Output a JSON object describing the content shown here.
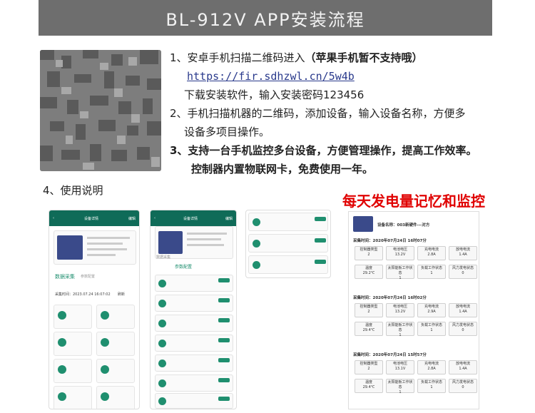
{
  "banner": {
    "title": "BL-912V APP安装流程"
  },
  "steps": {
    "s1": "1、安卓手机扫描二维码进入",
    "s1_bold": "（苹果手机暂不支持哦）",
    "link": "https://fir.sdhzwl.cn/5w4b",
    "s1b": "下载安装软件，输入安装密码123456",
    "s2a": "2、手机扫描机器的二维码，添加设备，输入设备名称，方便多",
    "s2b": "设备多项目操作。",
    "s3a": "3、支持一台手机监控多台设备，方便管理操作，提高工作效率。",
    "s3b": "控制器内置物联网卡，免费使用一年。"
  },
  "usage": {
    "label": "4、使用说明"
  },
  "red_title": "每天发电量记忆和监控",
  "phone1": {
    "top_title": "设备详情",
    "top_right": "编辑",
    "tab1": "数据采集",
    "tab2": "参数配置",
    "time": "采集时间：2023.07.24 16:07:02",
    "refresh": "刷新"
  },
  "phone2": {
    "top_title": "设备详情",
    "top_right": "编辑",
    "tab1": "数据采集",
    "tab2": "参数配置"
  },
  "records": {
    "device": "设备名称：003新硬件---对方",
    "blocks": [
      {
        "time": "采集时间：2020年07月24日 16时07分",
        "r1": [
          [
            "控制器类型",
            "2"
          ],
          [
            "电池电压",
            "13.2V"
          ],
          [
            "充电电流",
            "2.8A"
          ],
          [
            "放电电流",
            "1.4A"
          ]
        ],
        "r2": [
          [
            "温度",
            "29.2℃"
          ],
          [
            "太阳能板工作状态",
            "1"
          ],
          [
            "负载工作状态",
            "1"
          ],
          [
            "风力发电状态",
            "0"
          ]
        ]
      },
      {
        "time": "采集时间：2020年07月24日 16时02分",
        "r1": [
          [
            "控制器类型",
            "2"
          ],
          [
            "电池电压",
            "13.2V"
          ],
          [
            "充电电流",
            "2.9A"
          ],
          [
            "放电电流",
            "1.4A"
          ]
        ],
        "r2": [
          [
            "温度",
            "29.4℃"
          ],
          [
            "太阳能板工作状态",
            "1"
          ],
          [
            "负载工作状态",
            "1"
          ],
          [
            "风力发电状态",
            "0"
          ]
        ]
      },
      {
        "time": "采集时间：2020年07月24日 15时57分",
        "r1": [
          [
            "控制器类型",
            "2"
          ],
          [
            "电池电压",
            "13.1V"
          ],
          [
            "充电电流",
            "2.8A"
          ],
          [
            "放电电流",
            "1.4A"
          ]
        ],
        "r2": [
          [
            "温度",
            "29.4℃"
          ],
          [
            "太阳能板工作状态",
            "1"
          ],
          [
            "负载工作状态",
            "1"
          ],
          [
            "风力发电状态",
            "0"
          ]
        ]
      }
    ]
  },
  "colors": {
    "banner": "#6e6e6e",
    "accent": "#1f8f6f",
    "red": "#e00000",
    "link": "#2a3a8c"
  },
  "icons": {
    "qr": "qr-code-icon"
  }
}
